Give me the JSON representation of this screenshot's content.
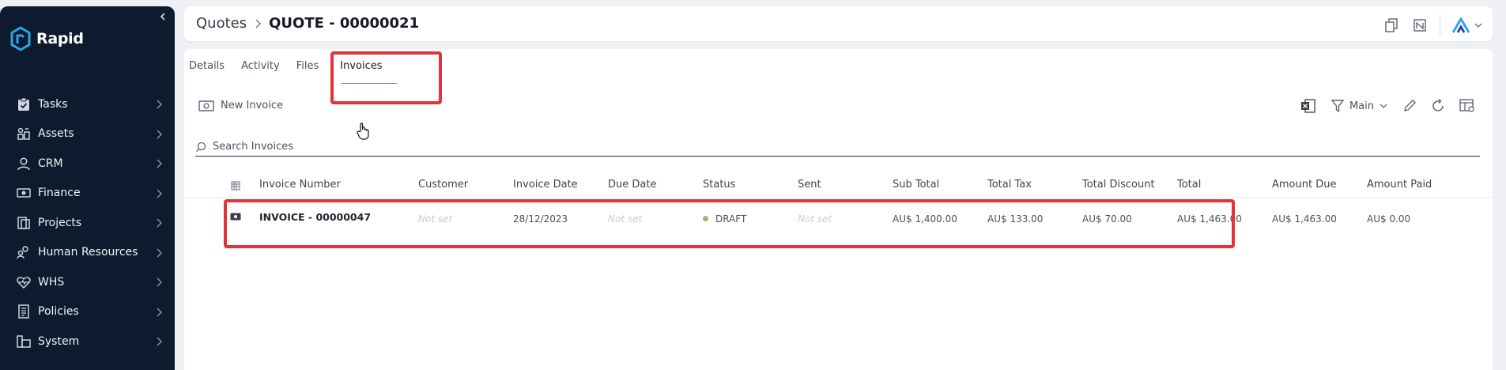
{
  "app": {
    "name": "Rapid",
    "brand_color": "#2aa6e6"
  },
  "sidebar": {
    "items": [
      {
        "label": "Tasks",
        "icon": "clipboard-check-icon"
      },
      {
        "label": "Assets",
        "icon": "assets-icon"
      },
      {
        "label": "CRM",
        "icon": "user-icon"
      },
      {
        "label": "Finance",
        "icon": "money-icon"
      },
      {
        "label": "Projects",
        "icon": "folders-icon"
      },
      {
        "label": "Human Resources",
        "icon": "people-icon"
      },
      {
        "label": "WHS",
        "icon": "heart-pulse-icon"
      },
      {
        "label": "Policies",
        "icon": "document-icon"
      },
      {
        "label": "System",
        "icon": "system-icon"
      }
    ]
  },
  "header": {
    "breadcrumb_parent": "Quotes",
    "breadcrumb_current": "QUOTE - 00000021"
  },
  "tabs": [
    {
      "label": "Details",
      "active": false
    },
    {
      "label": "Activity",
      "active": false
    },
    {
      "label": "Files",
      "active": false
    },
    {
      "label": "Invoices",
      "active": true
    }
  ],
  "toolbar": {
    "new_invoice_label": "New Invoice",
    "view_label": "Main"
  },
  "search": {
    "placeholder": "Search Invoices"
  },
  "table": {
    "columns": [
      "Invoice Number",
      "Customer",
      "Invoice Date",
      "Due Date",
      "Status",
      "Sent",
      "Sub Total",
      "Total Tax",
      "Total Discount",
      "Total",
      "Amount Due",
      "Amount Paid"
    ],
    "rows": [
      {
        "invoice_number": "INVOICE - 00000047",
        "customer": "Not set",
        "invoice_date": "28/12/2023",
        "due_date": "Not set",
        "status": "DRAFT",
        "status_color": "#9bb56b",
        "sent": "Not set",
        "sub_total": "AU$ 1,400.00",
        "total_tax": "AU$ 133.00",
        "total_discount": "AU$ 70.00",
        "total": "AU$ 1,463.00",
        "amount_due": "AU$ 1,463.00",
        "amount_paid": "AU$ 0.00"
      }
    ]
  },
  "highlight_color": "#e0343a"
}
